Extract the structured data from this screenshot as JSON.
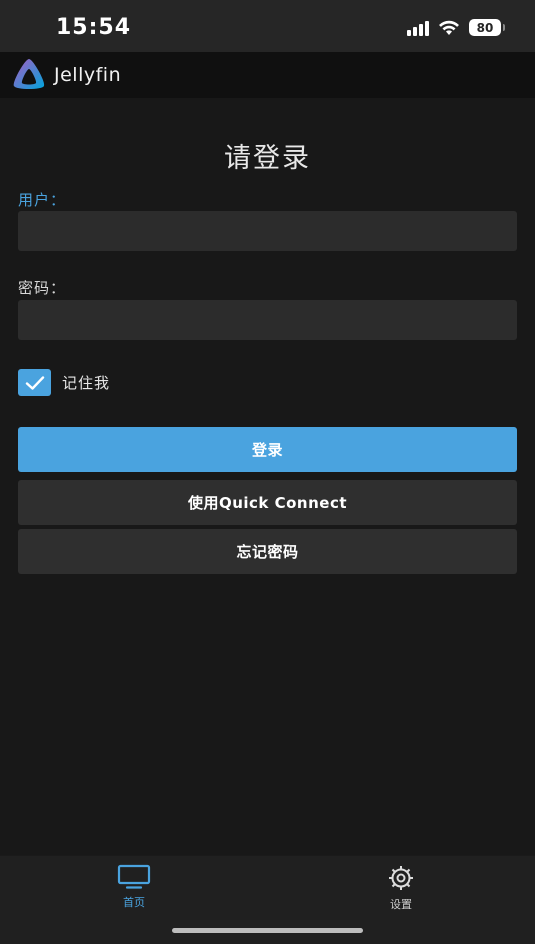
{
  "status_bar": {
    "time": "15:54",
    "battery": "80",
    "icons": [
      "signal-icon",
      "wifi-icon",
      "battery-icon"
    ]
  },
  "header": {
    "app_name": "Jellyfin",
    "logo_icon": "jellyfin-logo"
  },
  "login": {
    "title": "请登录",
    "username_label": "用户：",
    "username_value": "",
    "password_label": "密码：",
    "password_value": "",
    "remember_label": "记住我",
    "remember_checked": true,
    "login_button": "登录",
    "quick_connect_button": "使用Quick Connect",
    "forgot_password_button": "忘记密码"
  },
  "tabbar": {
    "tabs": [
      {
        "label": "首页",
        "icon": "tv-icon",
        "active": true
      },
      {
        "label": "设置",
        "icon": "gear-icon",
        "active": false
      }
    ]
  },
  "colors": {
    "accent": "#4aa3df",
    "background": "#181818",
    "input_background": "#2c2c2c",
    "secondary_button": "#2f2f2f"
  }
}
